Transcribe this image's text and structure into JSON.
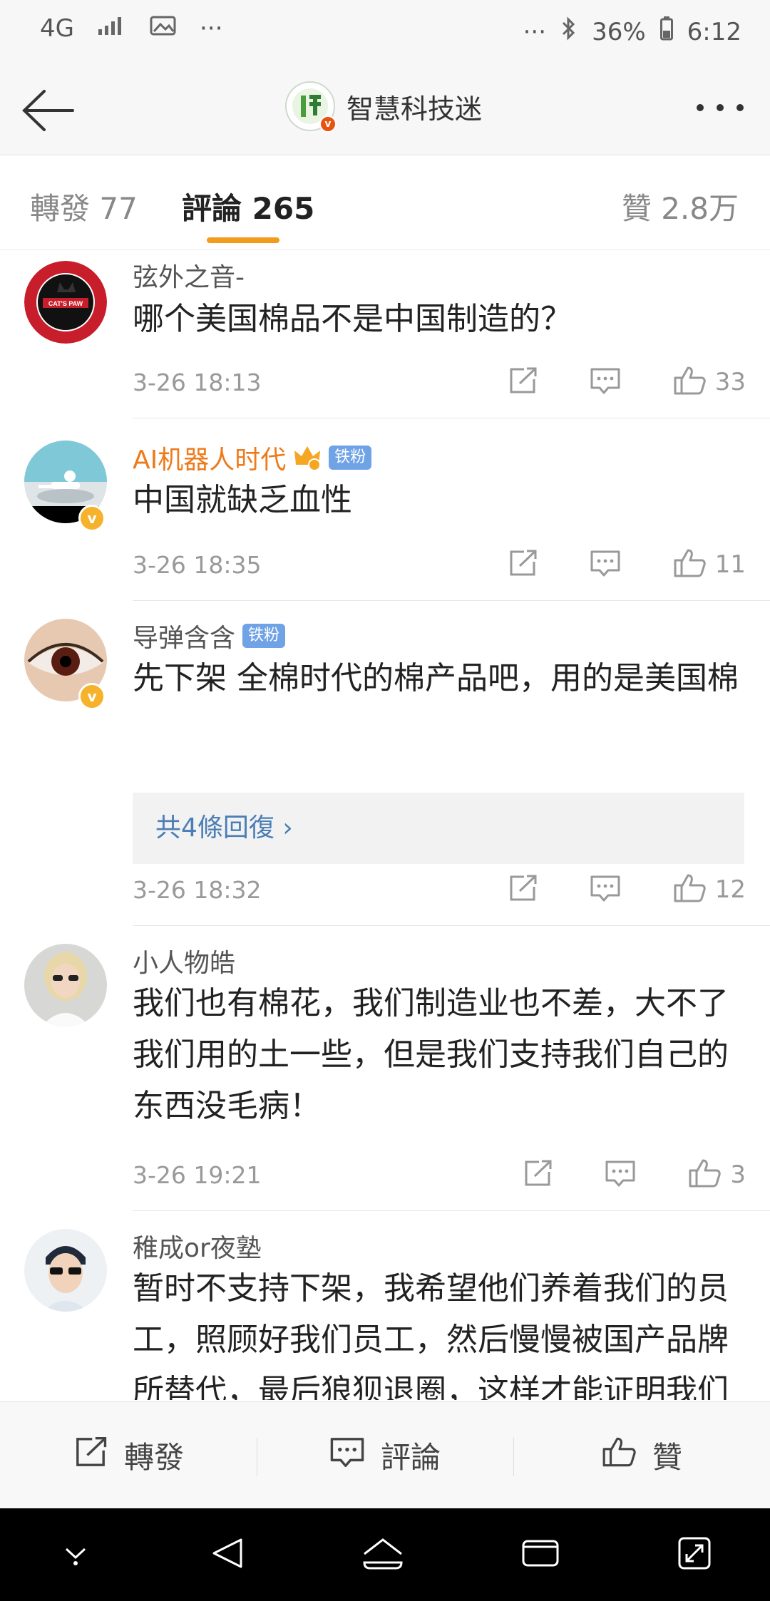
{
  "status_bar": {
    "network": "4G",
    "dots": "···",
    "battery": "36%",
    "time": "6:12"
  },
  "header": {
    "account_name": "智慧科技迷",
    "verified_mark": "v"
  },
  "tabs": [
    {
      "label": "轉發 77"
    },
    {
      "label": "評論 265"
    },
    {
      "label": "贊 2.8万"
    }
  ],
  "comments": [
    {
      "user": "弦外之音-",
      "text": "哪个美国棉品不是中国制造的？",
      "time": "3-26 18:13",
      "likes": "33",
      "badge": ""
    },
    {
      "user": "AI机器人时代",
      "text": "中国就缺乏血性",
      "time": "3-26 18:35",
      "likes": "11",
      "badge": "铁粉"
    },
    {
      "user": "导弹含含",
      "text": "先下架 全棉时代的棉产品吧，用的是美国棉",
      "time": "3-26 18:32",
      "likes": "12",
      "badge": "铁粉",
      "replies": "共4條回復 ›"
    },
    {
      "user": "小人物皓",
      "text": "我们也有棉花，我们制造业也不差，大不了我们用的土一些，但是我们支持我们自己的东西没毛病！",
      "time": "3-26 19:21",
      "likes": "3",
      "badge": ""
    },
    {
      "user": "稚成or夜塾",
      "text": "暂时不支持下架，我希望他们养着我们的员工，照顾好我们员工，然后慢慢被国产品牌所替代，最后狼狈退圈，这样才能证明我们",
      "time": "",
      "likes": "",
      "badge": ""
    }
  ],
  "bottom_bar": {
    "repost": "轉發",
    "comment": "評論",
    "like": "贊"
  },
  "colors": {
    "accent": "#f29b1d",
    "username_orange": "#ee7a1a",
    "link_blue": "#4a7eb5",
    "fan_badge": "#6fa3e6"
  }
}
